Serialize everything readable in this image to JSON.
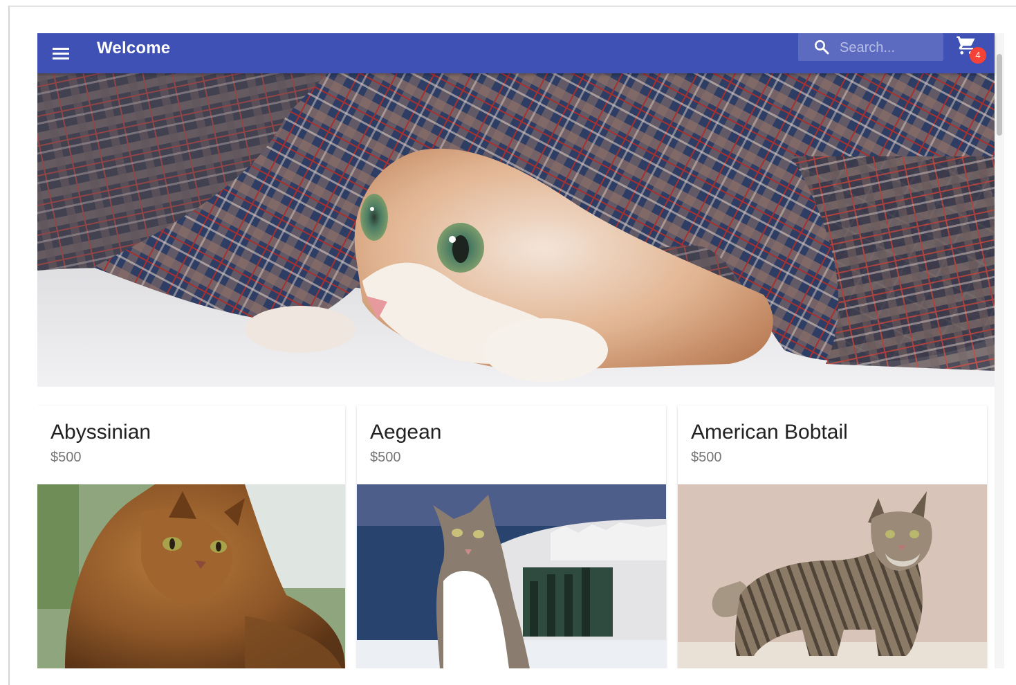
{
  "appbar": {
    "title": "Welcome",
    "menu_icon": "menu-icon",
    "search_placeholder": "Search...",
    "search_value": "",
    "cart_icon": "shopping-cart-icon",
    "cart_count": "4"
  },
  "colors": {
    "primary": "#3f51b5",
    "search_background": "#5c6bc0",
    "badge": "#f44336"
  },
  "hero": {
    "image": "hero-cat-image",
    "description_visible": false
  },
  "products": [
    {
      "name": "Abyssinian",
      "price": "$500",
      "image": "abyssinian-cat-image"
    },
    {
      "name": "Aegean",
      "price": "$500",
      "image": "aegean-cat-image"
    },
    {
      "name": "American Bobtail",
      "price": "$500",
      "image": "american-bobtail-cat-image"
    }
  ]
}
